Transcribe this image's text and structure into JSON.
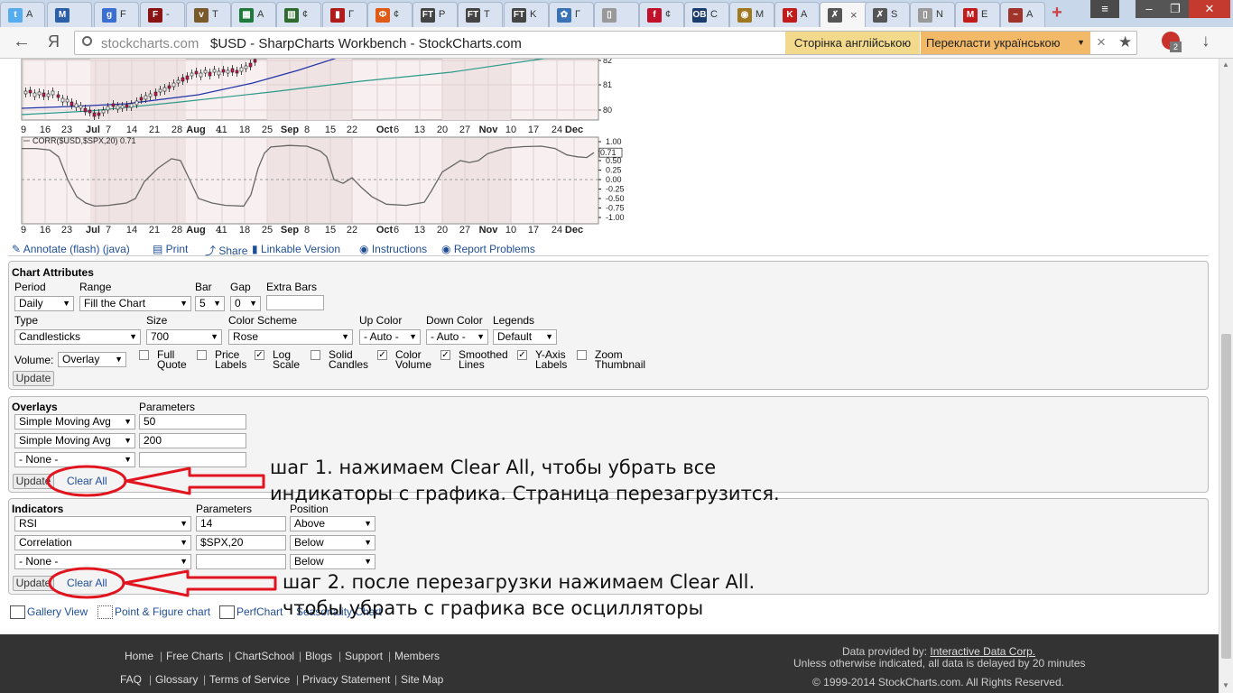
{
  "browser": {
    "tabs": [
      {
        "label": "A",
        "icon": "twitter-icon",
        "color": "#55acee",
        "glyph": "t"
      },
      {
        "label": "",
        "icon": "mail-icon",
        "color": "#2a5fa8",
        "glyph": "M"
      },
      {
        "label": "F",
        "icon": "google-plus-icon",
        "color": "#3b6fd1",
        "glyph": "g"
      },
      {
        "label": "-",
        "icon": "f-icon",
        "color": "#8a1212",
        "glyph": "F"
      },
      {
        "label": "T",
        "icon": "vip-icon",
        "color": "#7a5a2a",
        "glyph": "v"
      },
      {
        "label": "A",
        "icon": "spreadsheet-icon",
        "color": "#1d7a3a",
        "glyph": "▦"
      },
      {
        "label": "¢",
        "icon": "chart-icon",
        "color": "#2e6b2e",
        "glyph": "▥"
      },
      {
        "label": "Г",
        "icon": "bars-icon",
        "color": "#b01b1b",
        "glyph": "▮"
      },
      {
        "label": "¢",
        "icon": "circle-icon",
        "color": "#e05a15",
        "glyph": "Ф"
      },
      {
        "label": "P",
        "icon": "ft-icon",
        "color": "#444",
        "glyph": "FT"
      },
      {
        "label": "T",
        "icon": "ft-icon",
        "color": "#444",
        "glyph": "FT"
      },
      {
        "label": "K",
        "icon": "ft-icon",
        "color": "#444",
        "glyph": "FT"
      },
      {
        "label": "Г",
        "icon": "flower-icon",
        "color": "#3a73b5",
        "glyph": "✿"
      },
      {
        "label": "",
        "icon": "page-icon",
        "color": "#999",
        "glyph": "▯"
      },
      {
        "label": "¢",
        "icon": "f-script-icon",
        "color": "#c0102a",
        "glyph": "f"
      },
      {
        "label": "C",
        "icon": "ob-icon",
        "color": "#1a3b6d",
        "glyph": "OB"
      },
      {
        "label": "M",
        "icon": "coin-icon",
        "color": "#a07820",
        "glyph": "◉"
      },
      {
        "label": "A",
        "icon": "flag-icon",
        "color": "#c21b1b",
        "glyph": "K"
      },
      {
        "label": "",
        "icon": "stockcharts-icon",
        "color": "#555",
        "glyph": "✗",
        "active": true,
        "close": "×"
      },
      {
        "label": "S",
        "icon": "stockcharts-icon",
        "color": "#555",
        "glyph": "✗"
      },
      {
        "label": "N",
        "icon": "page-icon",
        "color": "#999",
        "glyph": "▯"
      },
      {
        "label": "E",
        "icon": "red-m-icon",
        "color": "#c21b1b",
        "glyph": "M"
      },
      {
        "label": "A",
        "icon": "bird-icon",
        "color": "#a0332a",
        "glyph": "~"
      }
    ],
    "new_tab": "+",
    "window_controls": [
      "≡",
      "–",
      "❐",
      "✕"
    ],
    "back": "←",
    "yandex": "Я",
    "url_domain": "stockcharts.com",
    "page_title": "$USD - SharpCharts Workbench - StockCharts.com",
    "translate_original": "Сторінка англійською",
    "translate_to": "Перекласти українською",
    "translate_close": "×",
    "star": "★",
    "abp_badge": "2",
    "download": "↓"
  },
  "chart": {
    "x_labels": [
      [
        "9",
        false
      ],
      [
        "16",
        false
      ],
      [
        "23",
        false
      ],
      [
        "Jul",
        true
      ],
      [
        "7",
        false
      ],
      [
        "14",
        false
      ],
      [
        "21",
        false
      ],
      [
        "28",
        false
      ],
      [
        "Aug",
        true
      ],
      [
        "4",
        false
      ],
      [
        "11",
        false
      ],
      [
        "18",
        false
      ],
      [
        "25",
        false
      ],
      [
        "Sep",
        true
      ],
      [
        "8",
        false
      ],
      [
        "15",
        false
      ],
      [
        "22",
        false
      ],
      [
        "Oct",
        true
      ],
      [
        "6",
        false
      ],
      [
        "13",
        false
      ],
      [
        "20",
        false
      ],
      [
        "27",
        false
      ],
      [
        "Nov",
        true
      ],
      [
        "10",
        false
      ],
      [
        "17",
        false
      ],
      [
        "24",
        false
      ],
      [
        "Dec",
        true
      ]
    ],
    "price_axis": [
      "82",
      "81",
      "80"
    ],
    "corr_axis": [
      "1.00",
      "0.75",
      "0.50",
      "0.25",
      "0.00",
      "-0.25",
      "-0.50",
      "-0.75",
      "-1.00"
    ],
    "corr_title": "CORR($USD,$SPX,20) 0.71",
    "corr_last": "0.71"
  },
  "toolbar": {
    "annotate": "Annotate (flash) (java)",
    "print": "Print",
    "share": "Share",
    "linkable": "Linkable Version",
    "instructions": "Instructions",
    "report": "Report Problems"
  },
  "attributes": {
    "title": "Chart Attributes",
    "period_label": "Period",
    "period": "Daily",
    "range_label": "Range",
    "range": "Fill the Chart",
    "bar_label": "Bar",
    "bar": "5",
    "gap_label": "Gap",
    "gap": "0",
    "extra_label": "Extra Bars",
    "extra": "",
    "type_label": "Type",
    "type": "Candlesticks",
    "size_label": "Size",
    "size": "700",
    "scheme_label": "Color Scheme",
    "scheme": "Rose",
    "up_label": "Up Color",
    "up": "- Auto -",
    "down_label": "Down Color",
    "down": "- Auto -",
    "legends_label": "Legends",
    "legends": "Default",
    "volume_label": "Volume:",
    "volume": "Overlay",
    "checkboxes": [
      {
        "l1": "Full",
        "l2": "Quote",
        "checked": false
      },
      {
        "l1": "Price",
        "l2": "Labels",
        "checked": false
      },
      {
        "l1": "Log",
        "l2": "Scale",
        "checked": true
      },
      {
        "l1": "Solid",
        "l2": "Candles",
        "checked": false
      },
      {
        "l1": "Color",
        "l2": "Volume",
        "checked": true
      },
      {
        "l1": "Smoothed",
        "l2": "Lines",
        "checked": true
      },
      {
        "l1": "Y-Axis",
        "l2": "Labels",
        "checked": true
      },
      {
        "l1": "Zoom",
        "l2": "Thumbnail",
        "checked": false
      }
    ],
    "update": "Update"
  },
  "overlays": {
    "title": "Overlays",
    "params_label": "Parameters",
    "rows": [
      {
        "type": "Simple Moving Avg",
        "param": "50"
      },
      {
        "type": "Simple Moving Avg",
        "param": "200"
      },
      {
        "type": "- None -",
        "param": ""
      }
    ],
    "update": "Update",
    "clear": "Clear All"
  },
  "indicators": {
    "title": "Indicators",
    "params_label": "Parameters",
    "position_label": "Position",
    "rows": [
      {
        "type": "RSI",
        "param": "14",
        "position": "Above"
      },
      {
        "type": "Correlation",
        "param": "$SPX,20",
        "position": "Below"
      },
      {
        "type": "- None -",
        "param": "",
        "position": "Below"
      }
    ],
    "update": "Update",
    "clear": "Clear All"
  },
  "notes": {
    "step1_line1": "шаг 1. нажимаем Clear All, чтобы убрать все",
    "step1_line2": "индикаторы с графика. Страница перезагрузится.",
    "step2_line1": "шаг 2. после перезагрузки нажимаем Clear All.",
    "step2_line2": "чтобы убрать с графика все осцилляторы",
    "annotation_color": "#e0151f"
  },
  "bottom_links": {
    "gallery": "Gallery View",
    "pnf": "Point & Figure chart",
    "perf": "PerfChart",
    "seasonality": "Seasonality Chart"
  },
  "footer": {
    "links_row1": [
      "Home",
      "Free Charts",
      "ChartSchool",
      "Blogs",
      "Support",
      "Members"
    ],
    "links_row2": [
      "FAQ",
      "Glossary",
      "Terms of Service",
      "Privacy Statement",
      "Site Map"
    ],
    "provided_prefix": "Data provided by:",
    "provided_link": "Interactive Data Corp.",
    "delay": "Unless otherwise indicated, all data is delayed by 20 minutes",
    "copyright": "© 1999-2014 StockCharts.com. All Rights Reserved."
  }
}
